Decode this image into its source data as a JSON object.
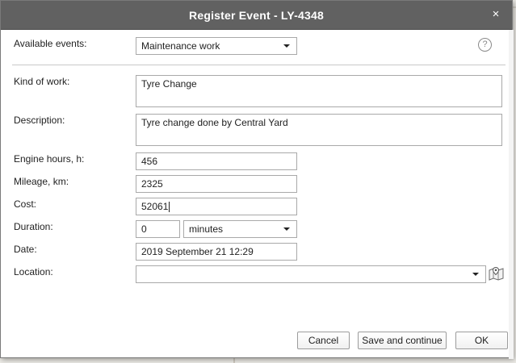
{
  "dialog": {
    "title": "Register Event - LY-4348",
    "close_glyph": "×",
    "help_glyph": "?"
  },
  "form": {
    "available_events": {
      "label": "Available events:",
      "value": "Maintenance work"
    },
    "kind_of_work": {
      "label": "Kind of work:",
      "value": "Tyre Change"
    },
    "description": {
      "label": "Description:",
      "value": "Tyre change done by Central Yard"
    },
    "engine_hours": {
      "label": "Engine hours, h:",
      "value": "456"
    },
    "mileage": {
      "label": "Mileage, km:",
      "value": "2325"
    },
    "cost": {
      "label": "Cost:",
      "value": "52061"
    },
    "duration": {
      "label": "Duration:",
      "value": "0",
      "unit": "minutes"
    },
    "date": {
      "label": "Date:",
      "value": "2019 September 21 12:29"
    },
    "location": {
      "label": "Location:",
      "value": ""
    }
  },
  "buttons": {
    "cancel": "Cancel",
    "save_continue": "Save and continue",
    "ok": "OK"
  },
  "colors": {
    "titlebar": "#616161",
    "border": "#a9a9a9"
  },
  "icons": [
    "close-icon",
    "help-icon",
    "dropdown-arrow-icon",
    "map-pin-icon"
  ]
}
